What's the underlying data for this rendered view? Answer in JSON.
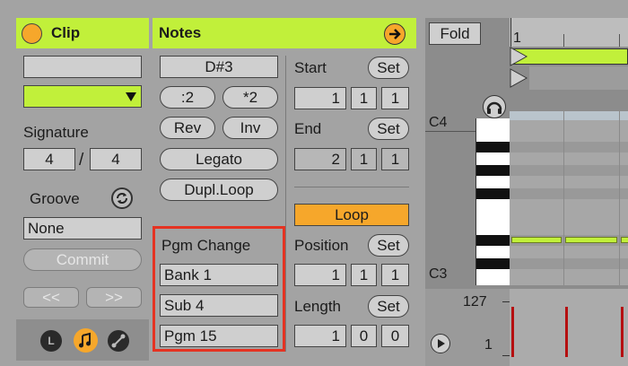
{
  "clip": {
    "title": "Clip",
    "name_value": "",
    "signature_label": "Signature",
    "sig_num": "4",
    "sig_sep": "/",
    "sig_den": "4",
    "groove_label": "Groove",
    "groove_value": "None",
    "commit_label": "Commit",
    "nudge_back": "<<",
    "nudge_fwd": ">>",
    "tab_l": "L",
    "accent_color": "#c1f03a"
  },
  "notes": {
    "title": "Notes",
    "pitch": "D#3",
    "div2": ":2",
    "mul2": "*2",
    "rev": "Rev",
    "inv": "Inv",
    "legato": "Legato",
    "dupl_loop": "Dupl.Loop",
    "pgm_change_label": "Pgm Change",
    "bank": "Bank 1",
    "sub": "Sub 4",
    "pgm": "Pgm 15",
    "start_label": "Start",
    "end_label": "End",
    "set": "Set",
    "start": [
      "1",
      "1",
      "1"
    ],
    "end": [
      "2",
      "1",
      "1"
    ],
    "loop_label": "Loop",
    "position_label": "Position",
    "position": [
      "1",
      "1",
      "1"
    ],
    "length_label": "Length",
    "length": [
      "1",
      "0",
      "0"
    ]
  },
  "editor": {
    "fold_label": "Fold",
    "ruler_mark": "1",
    "c4_label": "C4",
    "c3_label": "C3",
    "vel_max": "127",
    "vel_min": "1"
  },
  "highlight_color": "#e53322",
  "loop_color": "#f6a72b"
}
